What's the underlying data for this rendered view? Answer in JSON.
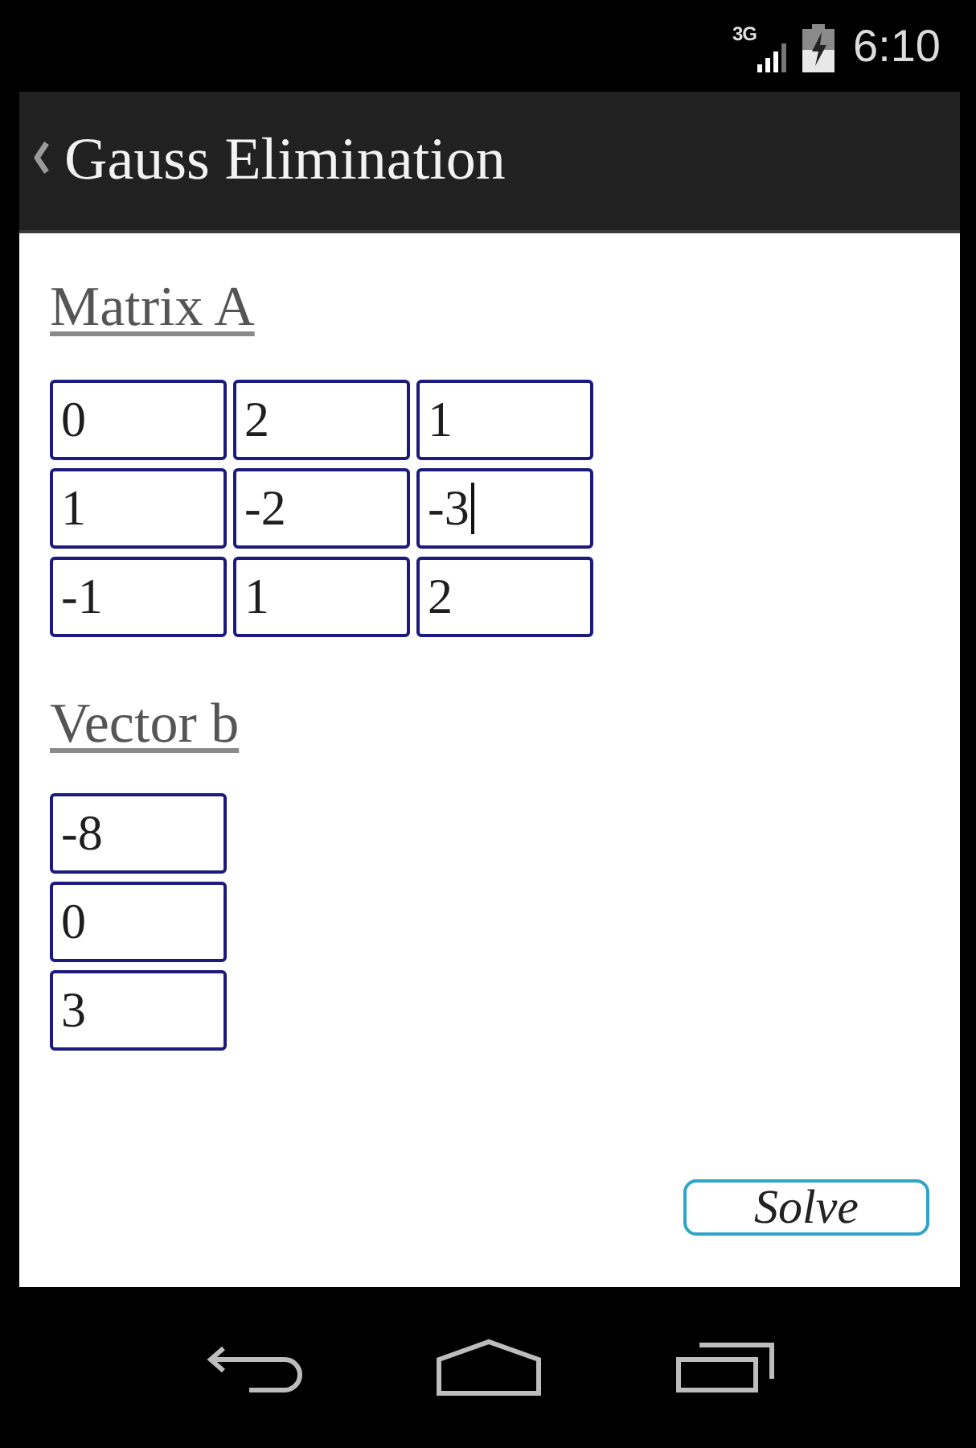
{
  "status_bar": {
    "network": "3G",
    "time": "6:10"
  },
  "action_bar": {
    "title": "Gauss Elimination"
  },
  "matrix": {
    "label": "Matrix A",
    "rows": [
      {
        "cells": [
          {
            "value": "0",
            "focused": false
          },
          {
            "value": "2",
            "focused": false
          },
          {
            "value": "1",
            "focused": false
          }
        ]
      },
      {
        "cells": [
          {
            "value": "1",
            "focused": false
          },
          {
            "value": "-2",
            "focused": false
          },
          {
            "value": "-3",
            "focused": true
          }
        ]
      },
      {
        "cells": [
          {
            "value": "-1",
            "focused": false
          },
          {
            "value": "1",
            "focused": false
          },
          {
            "value": "2",
            "focused": false
          }
        ]
      }
    ]
  },
  "vector": {
    "label": "Vector b",
    "cells": [
      {
        "value": "-8",
        "focused": false
      },
      {
        "value": "0",
        "focused": false
      },
      {
        "value": "3",
        "focused": false
      }
    ]
  },
  "solve_button": {
    "label": "Solve"
  }
}
